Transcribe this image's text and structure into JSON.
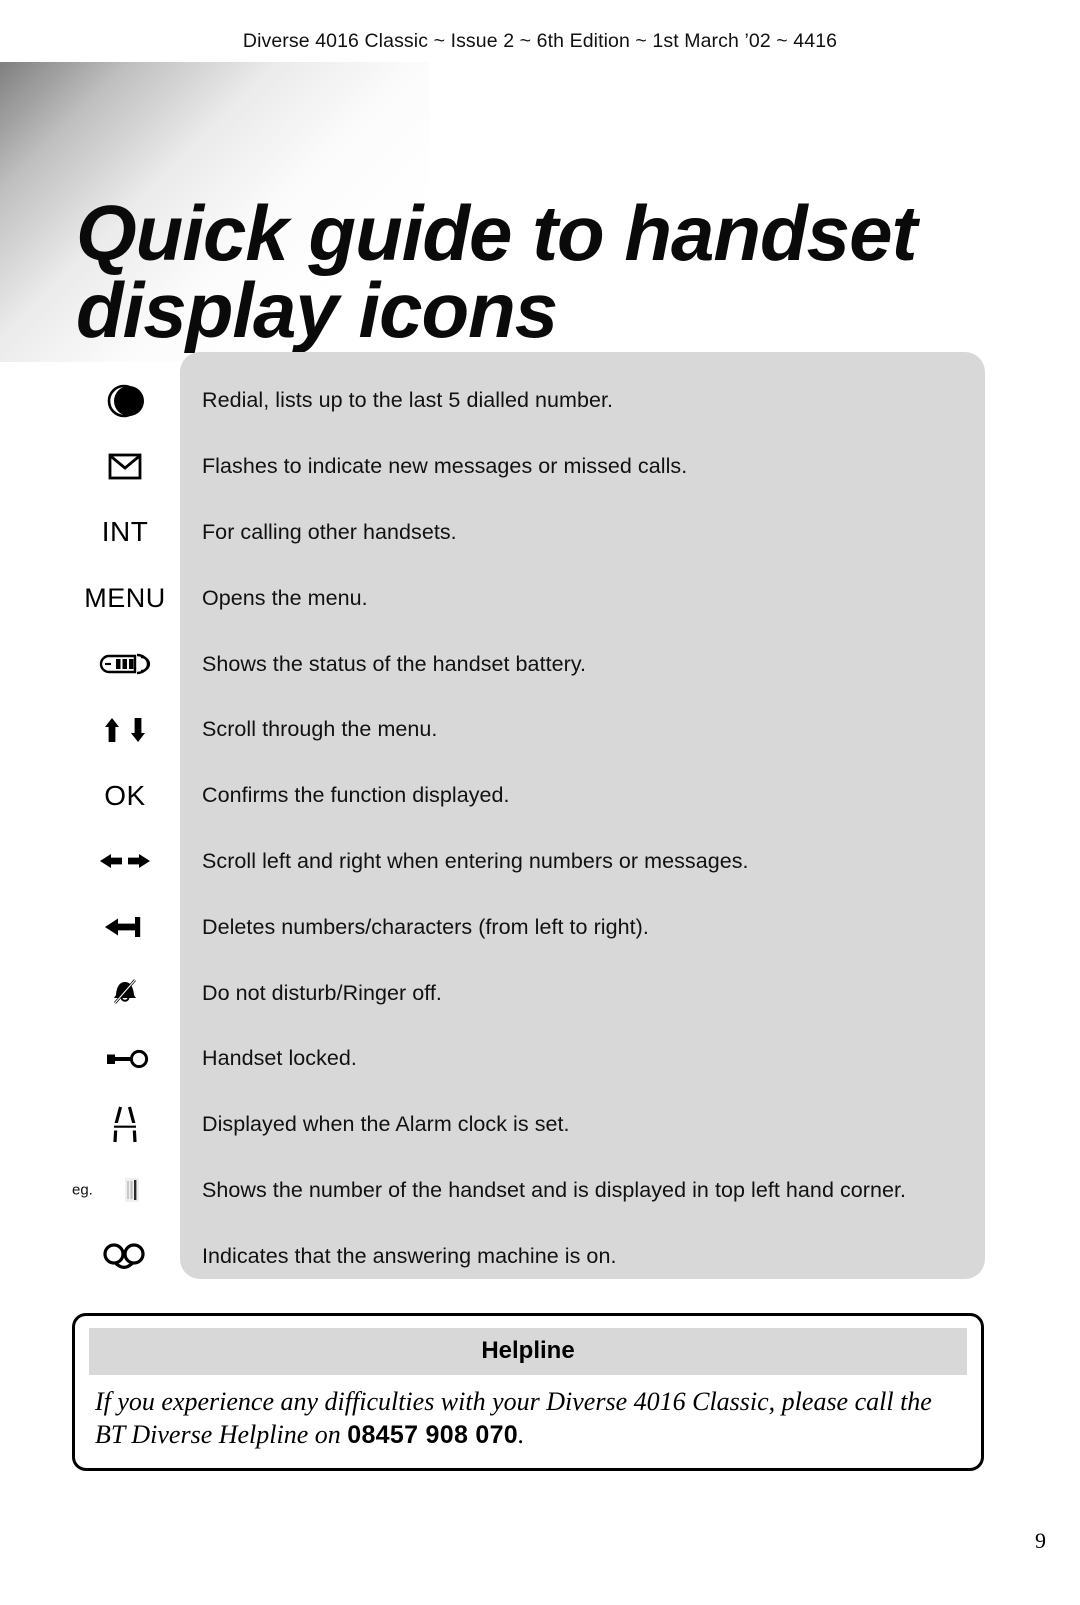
{
  "header": {
    "running_head": "Diverse 4016 Classic ~ Issue 2 ~ 6th Edition ~ 1st March ’02 ~ 4416"
  },
  "title": {
    "line1": "Quick guide to handset",
    "line2": "display icons"
  },
  "icon_table": {
    "rows": [
      {
        "icon": "redial-moon-icon",
        "icon_text": "",
        "prefix": "",
        "description": "Redial, lists up to the last 5 dialled number."
      },
      {
        "icon": "envelope-icon",
        "icon_text": "",
        "prefix": "",
        "description": "Flashes to indicate new messages or missed calls."
      },
      {
        "icon": "int-text-icon",
        "icon_text": "INT",
        "prefix": "",
        "description": "For calling other handsets."
      },
      {
        "icon": "menu-text-icon",
        "icon_text": "MENU",
        "prefix": "",
        "description": "Opens the menu."
      },
      {
        "icon": "battery-icon",
        "icon_text": "",
        "prefix": "",
        "description": "Shows the status of the handset battery."
      },
      {
        "icon": "up-down-arrows-icon",
        "icon_text": "",
        "prefix": "",
        "description": "Scroll through the menu."
      },
      {
        "icon": "ok-text-icon",
        "icon_text": "OK",
        "prefix": "",
        "description": "Confirms the function displayed."
      },
      {
        "icon": "left-right-arrows-icon",
        "icon_text": "",
        "prefix": "",
        "description": "Scroll left and right when entering numbers or messages."
      },
      {
        "icon": "backspace-arrow-icon",
        "icon_text": "",
        "prefix": "",
        "description": "Deletes numbers/characters (from left to right)."
      },
      {
        "icon": "bell-crossed-icon",
        "icon_text": "",
        "prefix": "",
        "description": "Do not disturb/Ringer off."
      },
      {
        "icon": "key-icon",
        "icon_text": "",
        "prefix": "",
        "description": "Handset locked."
      },
      {
        "icon": "alarm-clock-icon",
        "icon_text": "",
        "prefix": "",
        "description": "Displayed when the Alarm clock is set."
      },
      {
        "icon": "handset-number-icon",
        "icon_text": "",
        "prefix": "eg.",
        "description": "Shows the number of the handset and is displayed in top left hand corner."
      },
      {
        "icon": "answering-machine-icon",
        "icon_text": "",
        "prefix": "",
        "description": "Indicates that the answering machine is on."
      }
    ]
  },
  "helpline": {
    "title": "Helpline",
    "text_before": "If you experience any difficulties with your Diverse 4016 Classic, please call the BT Diverse Helpline on ",
    "phone": "08457 908 070",
    "text_after": "."
  },
  "footer": {
    "page_number": "9"
  },
  "colors": {
    "panel_grey": "#d8d8d8",
    "text_black": "#111111",
    "page_background": "#ffffff"
  }
}
